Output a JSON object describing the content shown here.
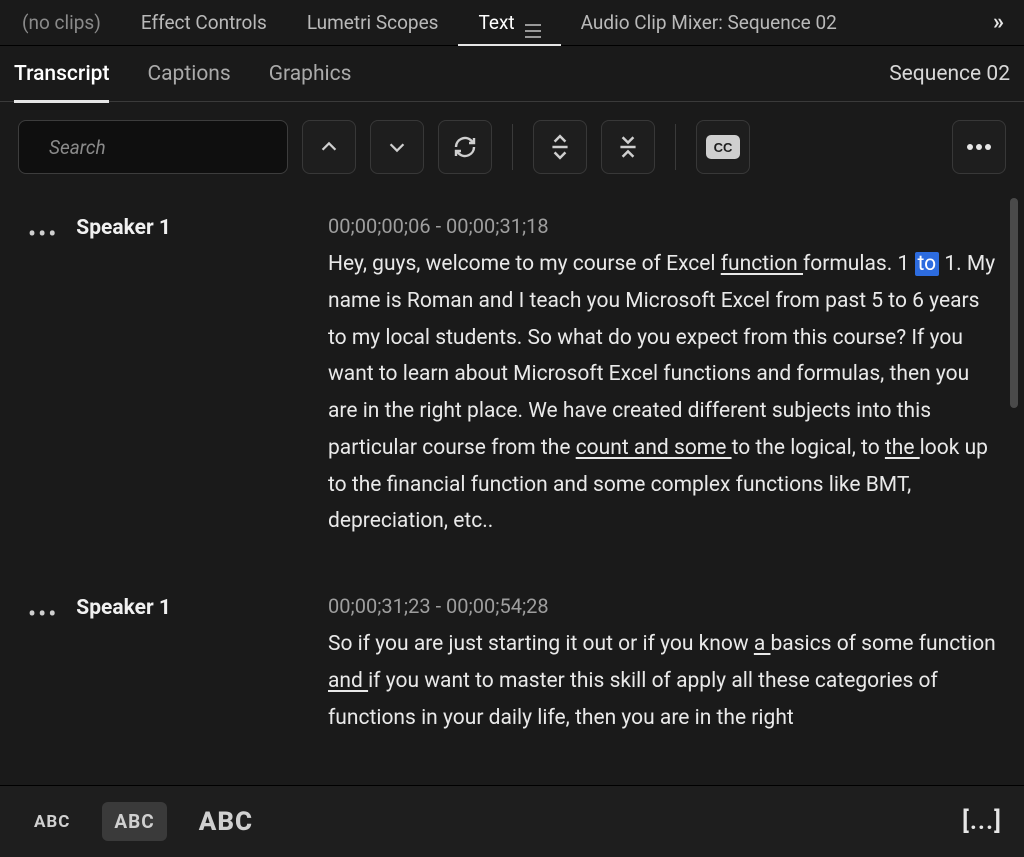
{
  "top_tabs": {
    "no_clips": "(no clips)",
    "effect_controls": "Effect Controls",
    "lumetri_scopes": "Lumetri Scopes",
    "text": "Text",
    "audio_clip_mixer": "Audio Clip Mixer: Sequence 02"
  },
  "sub_tabs": {
    "transcript": "Transcript",
    "captions": "Captions",
    "graphics": "Graphics",
    "sequence_label": "Sequence 02"
  },
  "search": {
    "placeholder": "Search"
  },
  "icons": {
    "search": "search-icon",
    "chevron_up": "chevron-up-icon",
    "chevron_down": "chevron-down-icon",
    "refresh": "refresh-icon",
    "split_v": "expand-vertical-icon",
    "merge_v": "collapse-vertical-icon",
    "cc": "CC",
    "more": "more-icon",
    "overflow": "»"
  },
  "segments": [
    {
      "speaker": "Speaker 1",
      "timecode": "00;00;00;06 - 00;00;31;18",
      "parts": [
        {
          "t": "Hey, guys, welcome to my course of Excel "
        },
        {
          "t": "function ",
          "ul": true
        },
        {
          "t": "formulas. 1 "
        },
        {
          "t": "to",
          "hl": true
        },
        {
          "t": " 1. My name is Roman and I teach you Microsoft Excel from past 5 to 6 years to my local students. So what do you expect from this course? If you want to learn about Microsoft Excel functions and formulas, then you are in the right place. We have created different subjects into this particular course from the "
        },
        {
          "t": "count and some ",
          "ul": true
        },
        {
          "t": "to the logical, to "
        },
        {
          "t": "the ",
          "ul": true
        },
        {
          "t": "look up to the financial function and some complex functions like BMT, depreciation, etc.."
        }
      ]
    },
    {
      "speaker": "Speaker 1",
      "timecode": "00;00;31;23 - 00;00;54;28",
      "parts": [
        {
          "t": "So if you are just starting it out or if you know "
        },
        {
          "t": "a ",
          "ul": true
        },
        {
          "t": "basics of some function "
        },
        {
          "t": "and ",
          "ul": true
        },
        {
          "t": "if you want to master this skill of apply all these categories of functions in your daily life, then you are in the right"
        }
      ]
    }
  ],
  "bottom": {
    "abc_small": "ABC",
    "abc_mid": "ABC",
    "abc_large": "ABC",
    "pause": "[...]"
  }
}
